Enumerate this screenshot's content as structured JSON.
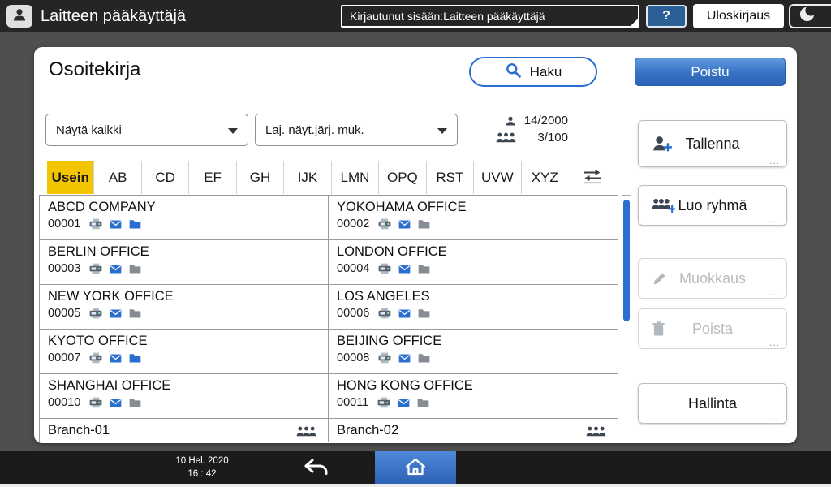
{
  "colors": {
    "accent_blue": "#2a6fd0",
    "active_tab_yellow": "#f2c500",
    "topbar_bg": "#252525",
    "disabled_text": "#b7bcc1"
  },
  "topbar": {
    "title": "Laitteen pääkäyttäjä",
    "login_status": "Kirjautunut sisään:Laitteen pääkäyttäjä",
    "help_label": "?",
    "logout_label": "Uloskirjaus"
  },
  "panel": {
    "title": "Osoitekirja",
    "search_label": "Haku",
    "exit_label": "Poistu",
    "filter_selected": "Näytä kaikki",
    "sort_selected": "Laj. näyt.järj. muk.",
    "counters": {
      "users": "14/2000",
      "groups": "3/100"
    },
    "tabs": [
      {
        "label": "Usein",
        "active": true
      },
      {
        "label": "AB",
        "active": false
      },
      {
        "label": "CD",
        "active": false
      },
      {
        "label": "EF",
        "active": false
      },
      {
        "label": "GH",
        "active": false
      },
      {
        "label": "IJK",
        "active": false
      },
      {
        "label": "LMN",
        "active": false
      },
      {
        "label": "OPQ",
        "active": false
      },
      {
        "label": "RST",
        "active": false
      },
      {
        "label": "UVW",
        "active": false
      },
      {
        "label": "XYZ",
        "active": false
      }
    ],
    "entries": [
      {
        "name": "ABCD COMPANY",
        "id": "00001",
        "icons": [
          "fax",
          "mail",
          "folder-blue"
        ]
      },
      {
        "name": "YOKOHAMA OFFICE",
        "id": "00002",
        "icons": [
          "fax",
          "mail",
          "folder"
        ]
      },
      {
        "name": "BERLIN OFFICE",
        "id": "00003",
        "icons": [
          "fax",
          "mail",
          "folder"
        ]
      },
      {
        "name": "LONDON OFFICE",
        "id": "00004",
        "icons": [
          "fax",
          "mail",
          "folder"
        ]
      },
      {
        "name": "NEW YORK OFFICE",
        "id": "00005",
        "icons": [
          "fax",
          "mail",
          "folder"
        ]
      },
      {
        "name": "LOS ANGELES",
        "id": "00006",
        "icons": [
          "fax",
          "mail",
          "folder"
        ]
      },
      {
        "name": "KYOTO OFFICE",
        "id": "00007",
        "icons": [
          "fax",
          "mail",
          "folder-blue"
        ]
      },
      {
        "name": "BEIJING OFFICE",
        "id": "00008",
        "icons": [
          "fax",
          "mail",
          "folder"
        ]
      },
      {
        "name": "SHANGHAI OFFICE",
        "id": "00010",
        "icons": [
          "fax",
          "mail",
          "folder"
        ]
      },
      {
        "name": "HONG KONG OFFICE",
        "id": "00011",
        "icons": [
          "fax",
          "mail",
          "folder"
        ]
      },
      {
        "name": "Branch-01",
        "id": "",
        "icons": [
          "group"
        ],
        "partial": true
      },
      {
        "name": "Branch-02",
        "id": "",
        "icons": [
          "group"
        ],
        "partial": true
      }
    ]
  },
  "sidebar": {
    "ellipsis": "...",
    "buttons": [
      {
        "label": "Tallenna",
        "icon": "person-add",
        "enabled": true
      },
      {
        "label": "Luo ryhmä",
        "icon": "group-add",
        "enabled": true
      },
      {
        "label": "Muokkaus",
        "icon": "pencil",
        "enabled": false
      },
      {
        "label": "Poista",
        "icon": "trash",
        "enabled": false
      },
      {
        "label": "Hallinta",
        "icon": "",
        "enabled": true
      }
    ]
  },
  "bottombar": {
    "date": "10 Hel. 2020",
    "time": "16 : 42"
  }
}
